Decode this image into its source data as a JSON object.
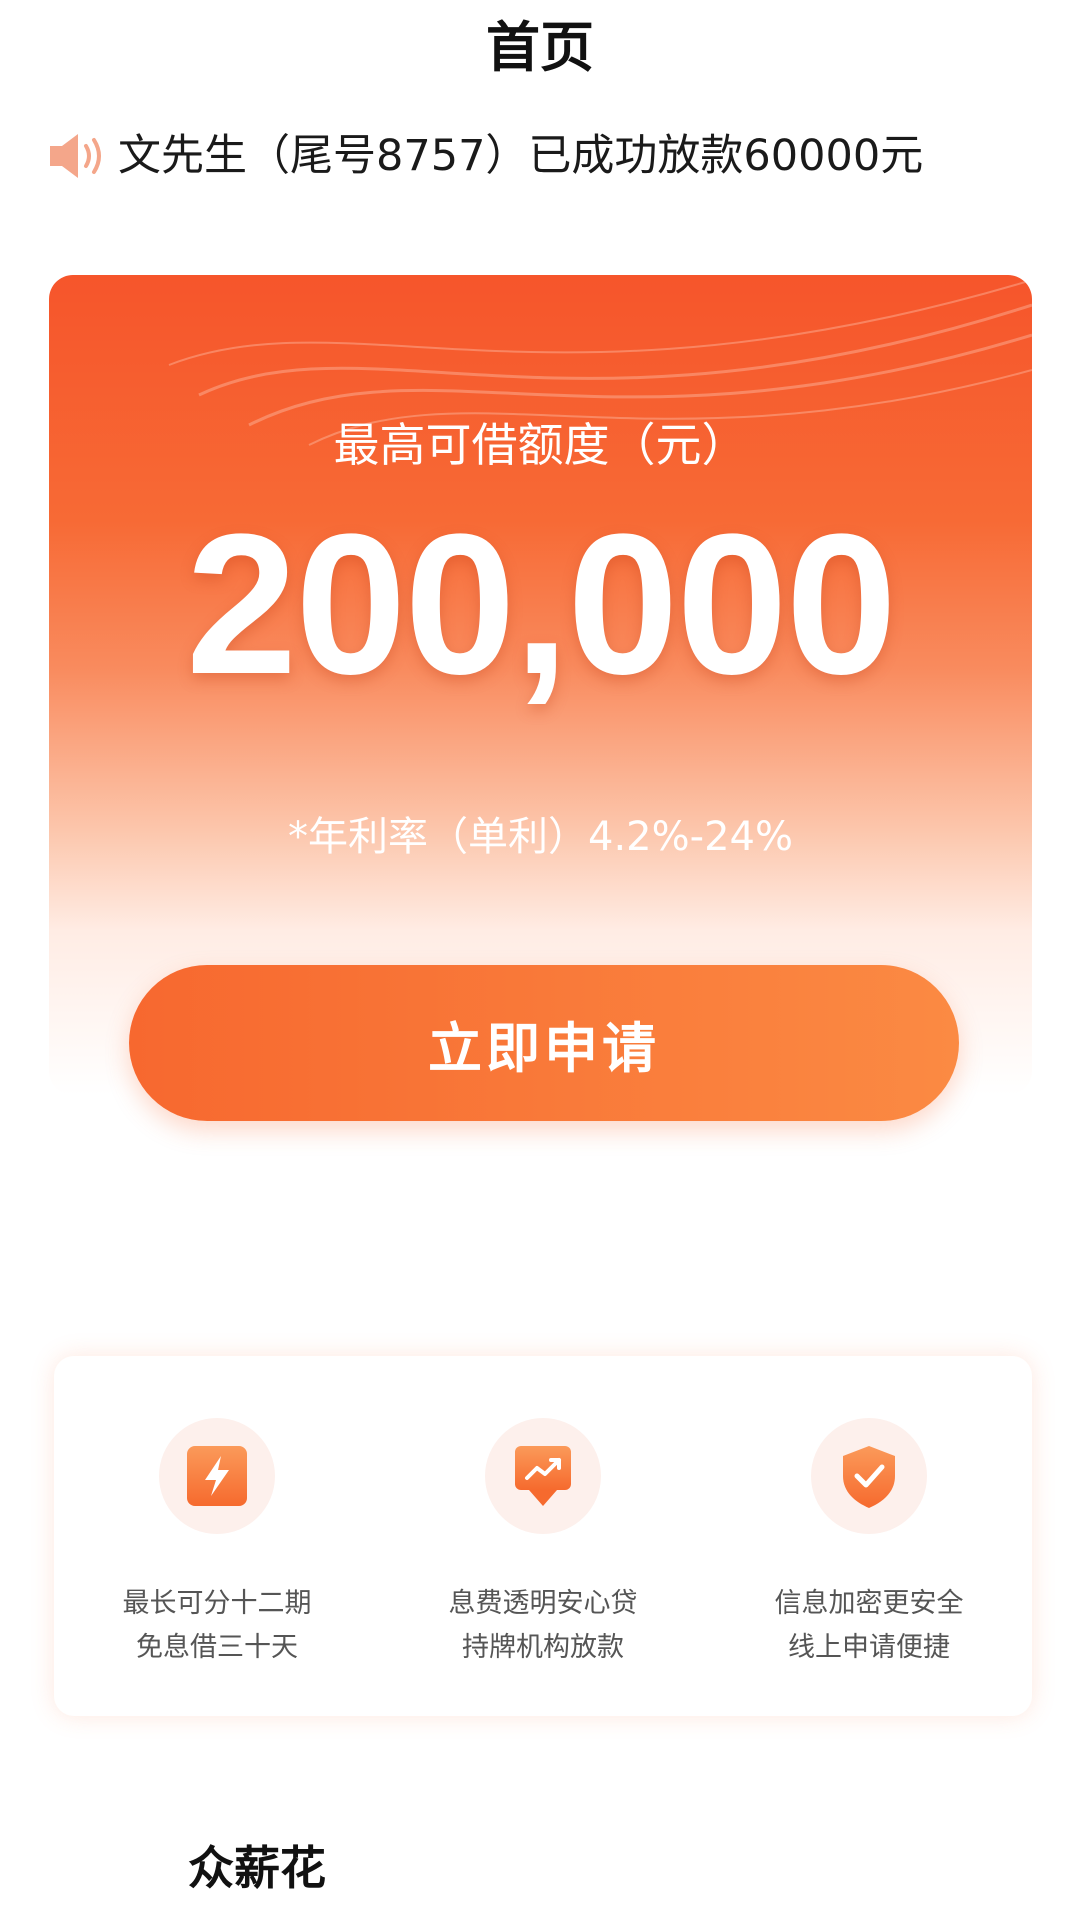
{
  "header": {
    "title": "首页"
  },
  "notice": {
    "icon": "speaker-icon",
    "text": "文先生（尾号8757）已成功放款60000元"
  },
  "hero": {
    "limit_label": "最高可借额度（元）",
    "limit_value": "200,000",
    "rate_text": "*年利率（单利）4.2%-24%"
  },
  "apply_button": {
    "label": "立即申请"
  },
  "features": [
    {
      "icon": "lightning-icon",
      "line1": "最长可分十二期",
      "line2": "免息借三十天"
    },
    {
      "icon": "trend-chart-icon",
      "line1": "息费透明安心贷",
      "line2": "持牌机构放款"
    },
    {
      "icon": "shield-check-icon",
      "line1": "信息加密更安全",
      "line2": "线上申请便捷"
    }
  ],
  "footer": {
    "brand": "众薪花"
  },
  "colors": {
    "accent": "#f7682f",
    "accent_light": "#fb8a43",
    "icon_bg": "#fdf0ec",
    "text_secondary": "#555555"
  }
}
